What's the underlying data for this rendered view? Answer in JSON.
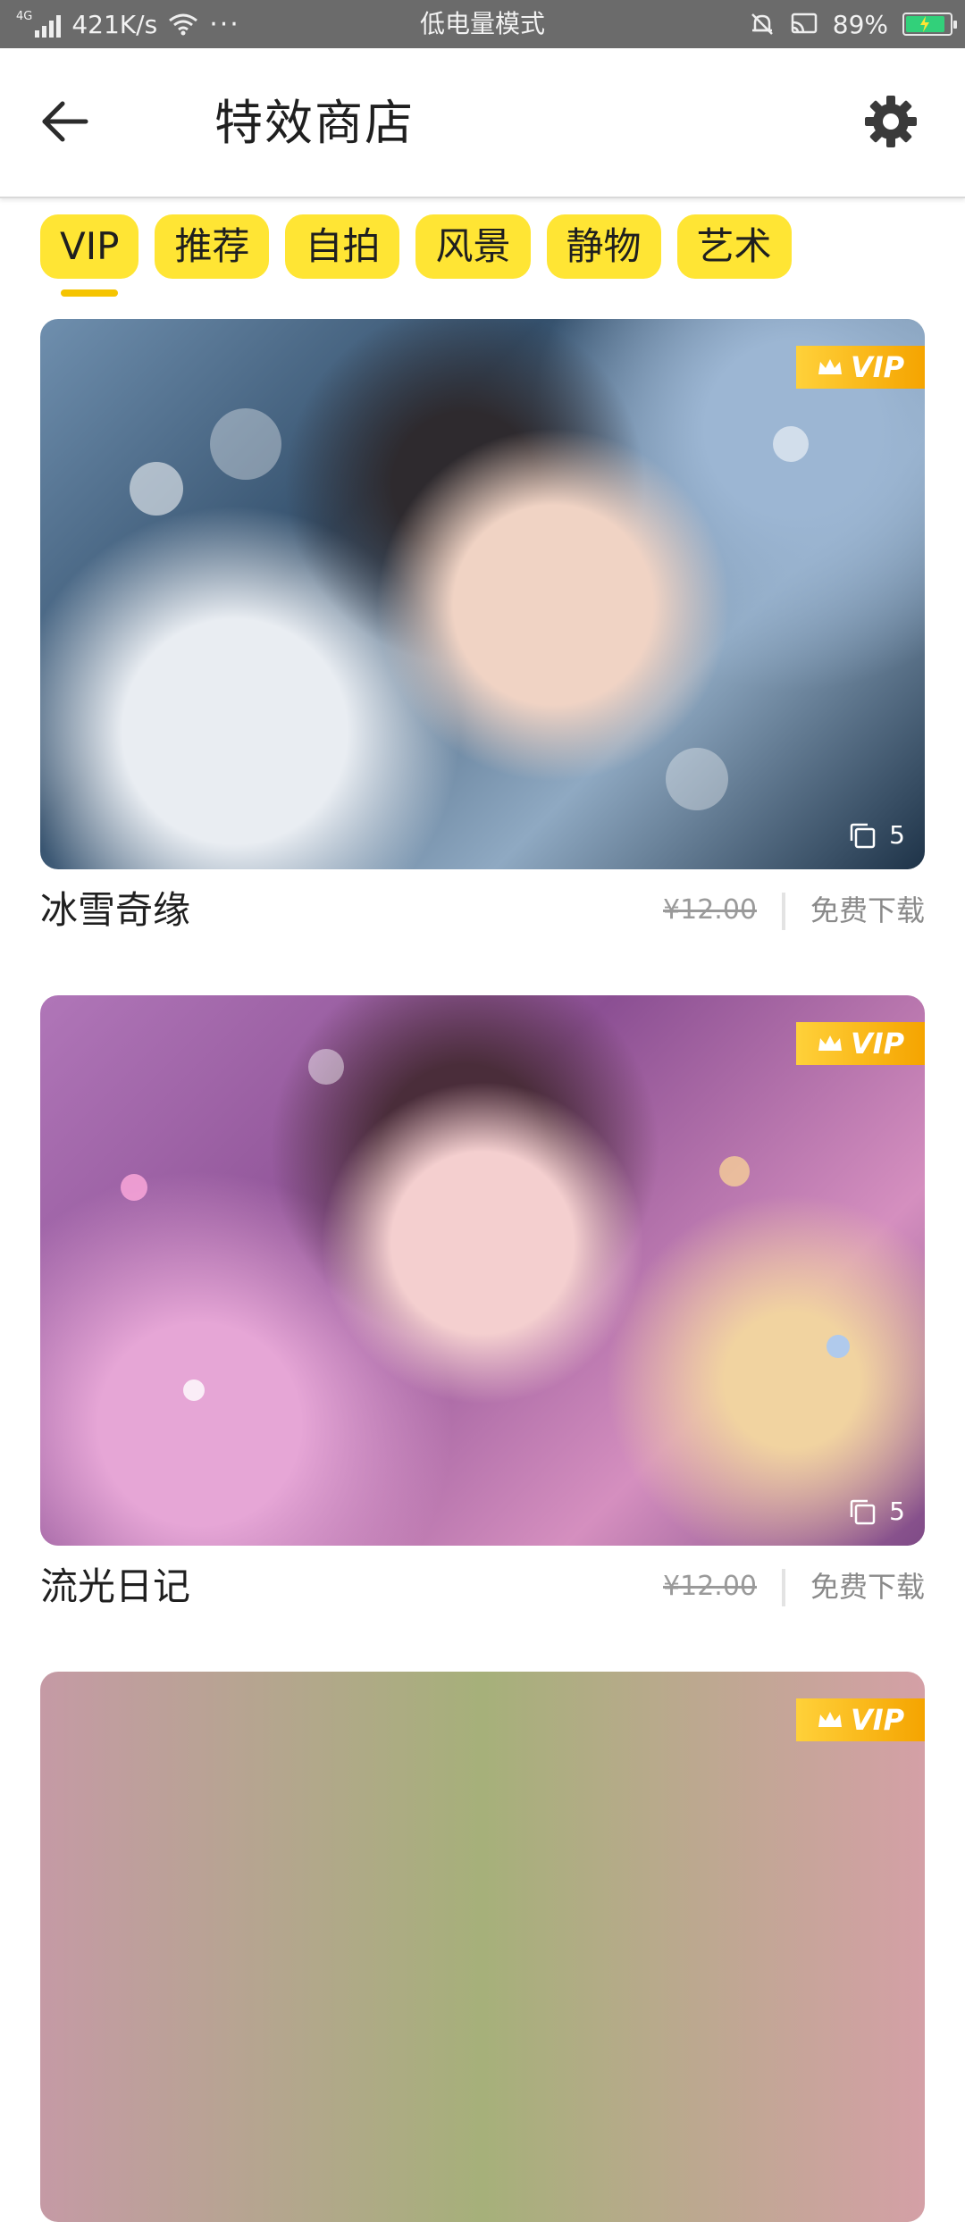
{
  "status_bar": {
    "network": "4G",
    "speed": "421K/s",
    "dots": "···",
    "mode": "低电量模式",
    "battery": "89%",
    "battery_level": 0.89
  },
  "header": {
    "title": "特效商店",
    "back_icon": "arrow-left-icon",
    "settings_icon": "gear-icon"
  },
  "tabs": [
    {
      "label": "VIP",
      "active": true
    },
    {
      "label": "推荐",
      "active": false
    },
    {
      "label": "自拍",
      "active": false
    },
    {
      "label": "风景",
      "active": false
    },
    {
      "label": "静物",
      "active": false
    },
    {
      "label": "艺术",
      "active": false
    }
  ],
  "items": [
    {
      "name": "冰雪奇缘",
      "price": "¥12.00",
      "action": "免费下载",
      "badge": "VIP",
      "count": "5"
    },
    {
      "name": "流光日记",
      "price": "¥12.00",
      "action": "免费下载",
      "badge": "VIP",
      "count": "5"
    },
    {
      "badge": "VIP"
    }
  ],
  "colors": {
    "accent": "#ffe534",
    "badge": "#f5a400",
    "status_bar": "#6b6b6b"
  }
}
